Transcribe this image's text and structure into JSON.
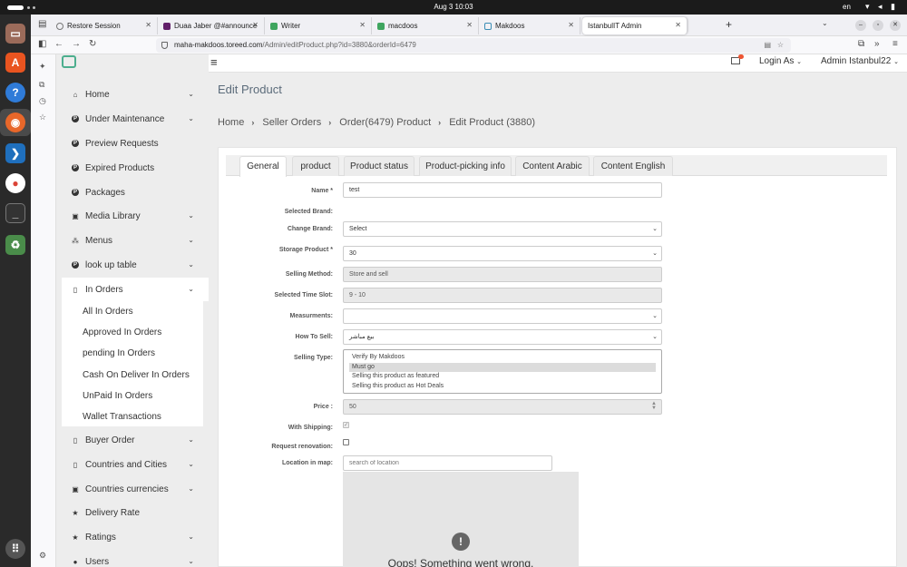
{
  "system": {
    "clock": "Aug 3  10:03",
    "lang": "en"
  },
  "browser": {
    "tabs": [
      {
        "label": "Restore Session"
      },
      {
        "label": "Duaa Jaber @#announce"
      },
      {
        "label": "Writer"
      },
      {
        "label": "macdoos"
      },
      {
        "label": "Makdoos"
      },
      {
        "label": "IstanbulIT Admin"
      }
    ],
    "url_host": "maha-makdoos.toreed.com",
    "url_path": "/Admin/editProduct.php?id=3880&orderId=6479"
  },
  "header": {
    "login_as": "Login As",
    "user": "Admin Istanbul22"
  },
  "sidebar": {
    "items": [
      {
        "label": "Home"
      },
      {
        "label": "Under Maintenance"
      },
      {
        "label": "Preview Requests"
      },
      {
        "label": "Expired Products"
      },
      {
        "label": "Packages"
      },
      {
        "label": "Media Library"
      },
      {
        "label": "Menus"
      },
      {
        "label": "look up table"
      },
      {
        "label": "In Orders"
      },
      {
        "label": "Buyer Order"
      },
      {
        "label": "Countries and Cities"
      },
      {
        "label": "Countries currencies"
      },
      {
        "label": "Delivery Rate"
      },
      {
        "label": "Ratings"
      },
      {
        "label": "Users"
      }
    ],
    "submenu": [
      {
        "label": "All In Orders"
      },
      {
        "label": "Approved In Orders"
      },
      {
        "label": "pending In Orders"
      },
      {
        "label": "Cash On Deliver In Orders"
      },
      {
        "label": "UnPaid In Orders"
      },
      {
        "label": "Wallet Transactions"
      }
    ]
  },
  "page": {
    "title": "Edit Product",
    "breadcrumb": [
      "Home",
      "Seller Orders",
      "Order(6479) Product",
      "Edit Product (3880)"
    ],
    "tabs": [
      "General",
      "product",
      "Product status",
      "Product-picking info",
      "Content Arabic",
      "Content English"
    ],
    "active_tab": "General"
  },
  "form": {
    "name": {
      "label": "Name *",
      "value": "test"
    },
    "selected_brand": {
      "label": "Selected Brand:"
    },
    "change_brand": {
      "label": "Change Brand:",
      "value": "Select"
    },
    "storage_product": {
      "label": "Storage Product *",
      "value": "30"
    },
    "selling_method": {
      "label": "Selling Method:",
      "value": "Store and sell"
    },
    "time_slot": {
      "label": "Selected Time Slot:",
      "value": "9 - 10"
    },
    "measurements": {
      "label": "Measurments:",
      "value": ""
    },
    "how_to_sell": {
      "label": "How To Sell:",
      "value": "بيع مباشر"
    },
    "selling_type": {
      "label": "Selling Type:",
      "options": [
        "Verify By Makdoos",
        "Must go",
        "Selling this product as featured",
        "Selling this product as Hot Deals"
      ],
      "selected": "Must go"
    },
    "price": {
      "label": "Price :",
      "value": "50"
    },
    "with_shipping": {
      "label": "With Shipping:",
      "checked": true
    },
    "request_renovation": {
      "label": "Request renovation:",
      "checked": false
    },
    "location": {
      "label": "Location in map:",
      "placeholder": "search of location"
    },
    "map_error": "Oops! Something went wrong."
  }
}
